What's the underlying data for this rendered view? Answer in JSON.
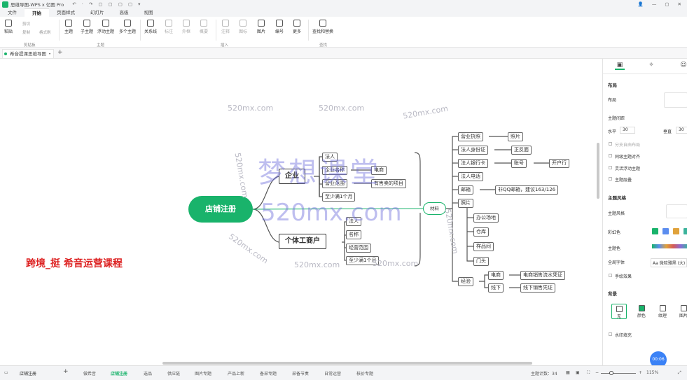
{
  "titlebar": {
    "title": "思维导图-WPS x 亿图 Pro",
    "quick_access": "↶ · ↷ ▢ ▢ ▢ ▢ ▾",
    "user_icons": "👤",
    "win_controls": [
      "—",
      "▢",
      "✕"
    ]
  },
  "menu_tabs": [
    "文件",
    "开始",
    "页面样式",
    "幻灯片",
    "高级",
    "视图"
  ],
  "ribbon": {
    "paste": "粘贴",
    "cut": "剪切",
    "copy": "复制",
    "format_painter": "格式刷",
    "clipboard_group": "剪贴板",
    "topic": "主题",
    "subtopic": "子主题",
    "floating_topic": "浮动主题",
    "multi_topic": "多个主题",
    "topic_group": "主题",
    "relation": "关系线",
    "callout": "标注",
    "outer_frame": "外框",
    "summary": "概要",
    "comment": "注释",
    "tag": "图标",
    "image": "图片",
    "numbering": "编号",
    "more": "更多",
    "insert_group": "插入",
    "find_replace": "查找和替换",
    "find_group": "查找"
  },
  "doc_tab": {
    "name": "希音提课思维导图",
    "add": "+"
  },
  "mindmap": {
    "root": "店铺注册",
    "qiye": "企业",
    "geti": "个体工商户",
    "qiye_children": [
      "法人",
      "企业名称",
      "营业范围",
      "至少满1个月"
    ],
    "dianshang": "电商",
    "youshou": "有售卖的项目",
    "geti_children": [
      "法人",
      "名称",
      "经营范围",
      "至少满1个月"
    ],
    "cailiao": "材料",
    "cailiao_children": [
      "营业执照",
      "法人身份证",
      "法人银行卡",
      "法人电话",
      "邮箱",
      "照片",
      "经验"
    ],
    "zhaopian_leaf": "照片",
    "zhengfan": "正反面",
    "zhanghao": "账号",
    "kaihu": "开户行",
    "email_note": "非QQ邮箱，建议163/126",
    "photo_children": [
      "办公场地",
      "仓库",
      "样品间",
      "门头"
    ],
    "exp_children": [
      "电商",
      "线下"
    ],
    "dianshang_proof": "电商销售流水凭证",
    "xianxia_proof": "线下销售凭证"
  },
  "overlays": {
    "watermark_big1": "梦想课堂",
    "watermark_big2": "520mx.com",
    "watermark_small": "520mx.com",
    "caption": "跨境_挺 希音运营课程"
  },
  "right_panel": {
    "tab_icons": [
      "layout-icon",
      "sparkle-icon",
      "emoji-icon"
    ],
    "layout_title": "布局",
    "layout_label": "布局",
    "spacing_title": "主题间距",
    "horizontal": "水平",
    "horizontal_value": "30",
    "vertical": "垂直",
    "vertical_value": "30",
    "opt1": "分支自由布局",
    "opt2": "同级主题对齐",
    "opt3": "灵活浮动主题",
    "opt4": "主题层叠",
    "style_title": "主题风格",
    "theme_style": "主题风格",
    "colorful": "彩虹色",
    "theme_color": "主题色",
    "font_label": "全局字体",
    "font_value": "Aa 微软雅黑 (大)",
    "hand_drawn": "手绘效果",
    "bg_title": "背景",
    "bg_none": "无",
    "bg_color": "颜色",
    "bg_texture": "纹理",
    "bg_image": "图片",
    "watermark": "水印填充",
    "timer": "00:06"
  },
  "colors": {
    "brand": "#19b36b",
    "caption": "#dd2222",
    "watermark": "#6e6edc"
  },
  "statusbar": {
    "page_icon": "▭",
    "current_sheet": "店铺注册",
    "add": "+",
    "sheets": [
      "做希音",
      "店铺注册",
      "选品",
      "供应链",
      "图片专题",
      "产品上新",
      "备采专题",
      "采备节奏",
      "日常运营",
      "核价专题"
    ],
    "topic_count": "主题计数：34",
    "zoom": "115%"
  }
}
